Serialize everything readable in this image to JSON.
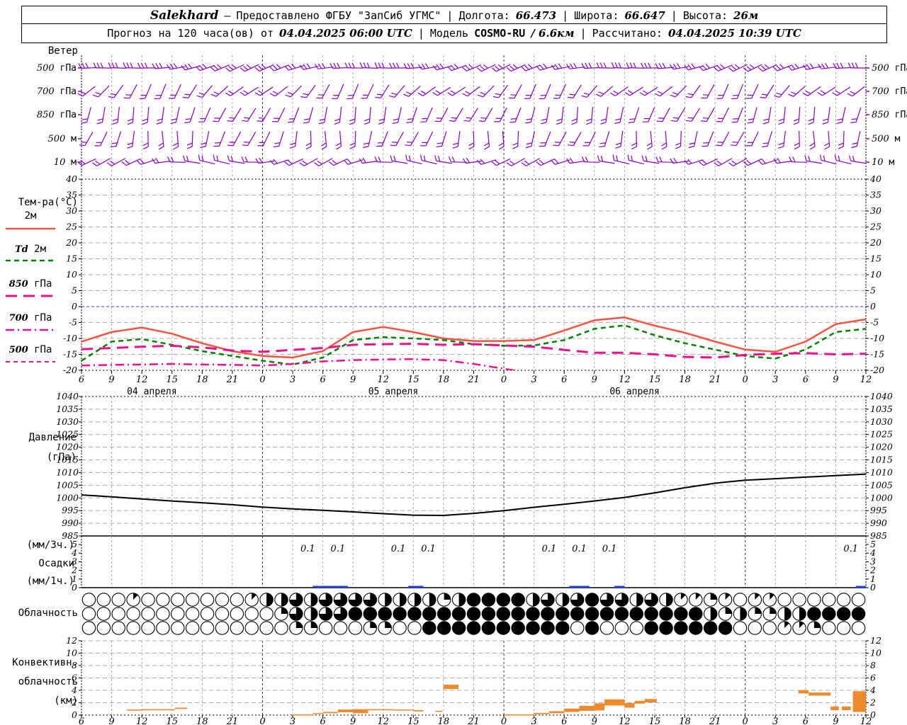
{
  "header": {
    "station": "Salekhard",
    "dash": "–",
    "provider": "Предоставлено ФГБУ \"ЗапСиб УГМС\"",
    "sep": "|",
    "lon_label": "Долгота:",
    "lon": "66.473",
    "lat_label": "Широта:",
    "lat": "66.647",
    "alt_label": "Высота:",
    "alt": "26м",
    "forecast_label": "Прогноз на 120 часа(ов) от",
    "forecast_time": "04.04.2025 06:00 UTC",
    "model_label": "Модель",
    "model_name": "COSMO-RU",
    "model_res": "/ 6.6км",
    "calc_label": "Рассчитано:",
    "calc_time": "04.04.2025 10:39 UTC"
  },
  "axis": {
    "start": "04.04.2025 06:00 UTC",
    "step_hours": 3,
    "hour_labels": [
      "6",
      "9",
      "12",
      "15",
      "18",
      "21",
      "0",
      "3",
      "6",
      "9",
      "12",
      "15",
      "18",
      "21",
      "0",
      "3",
      "6",
      "9",
      "12",
      "15",
      "18",
      "21",
      "0",
      "3",
      "6",
      "9",
      "12"
    ],
    "date_labels": [
      "04 апреля",
      "05 апреля",
      "06 апреля"
    ],
    "date_center_t": [
      7,
      31,
      55
    ]
  },
  "chart_data": [
    {
      "id": "wind",
      "type": "wind-barbs",
      "title": "Ветер",
      "color": "#8B00CB",
      "n_barbs": 53,
      "levels": [
        {
          "num": "500",
          "unit": "гПа",
          "base": -12,
          "amp": 14,
          "period": 17,
          "phase": 2,
          "ticks": 3
        },
        {
          "num": "700",
          "unit": "гПа",
          "base": -50,
          "amp": 18,
          "period": 13,
          "phase": 5,
          "ticks": 2
        },
        {
          "num": "850",
          "unit": "гПа",
          "base": -72,
          "amp": 14,
          "period": 15,
          "phase": 8,
          "ticks": 2
        },
        {
          "num": "500",
          "unit": "м",
          "base": -78,
          "amp": 18,
          "period": 11,
          "phase": 3,
          "ticks": 2
        },
        {
          "num": "10",
          "unit": "м",
          "base": -8,
          "amp": 22,
          "period": 14,
          "phase": 9,
          "ticks": 2
        }
      ]
    },
    {
      "id": "temperature",
      "type": "line",
      "title": "Тем-ра(°C)",
      "ylim": [
        -20,
        40
      ],
      "ytick_step": 5,
      "zero_line_color": "#3A3AFF",
      "x_step_hours": 3,
      "series": [
        {
          "label_num": "",
          "label_unit": "2м",
          "dash": "solid",
          "color": "#F9523E",
          "values": [
            -11,
            -8,
            -6.6,
            -8.5,
            -11.5,
            -14,
            -15.5,
            -16,
            -14,
            -8,
            -6.4,
            -8,
            -10,
            -10.8,
            -10.8,
            -10.5,
            -7.5,
            -4.3,
            -3.4,
            -6,
            -8.2,
            -11,
            -13.5,
            -14.2,
            -11,
            -5.5,
            -4
          ]
        },
        {
          "label_num": "Td",
          "label_unit": "2м",
          "dash": "dash",
          "color": "#008200",
          "values": [
            -17,
            -11,
            -10.2,
            -12,
            -14,
            -15.5,
            -17,
            -18.2,
            -16,
            -10.5,
            -9.6,
            -10,
            -10.5,
            -11.8,
            -12.3,
            -12.2,
            -10.5,
            -7,
            -5.9,
            -9,
            -11.5,
            -13.5,
            -15.5,
            -16.3,
            -13.5,
            -8,
            -7
          ]
        },
        {
          "label_num": "850",
          "label_unit": "гПа",
          "dash": "longdash",
          "color": "#EE1289",
          "values": [
            -13.4,
            -13,
            -12.6,
            -12.3,
            -12.8,
            -13.8,
            -14.2,
            -13.6,
            -13,
            -12,
            -11.8,
            -11.7,
            -12,
            -11.8,
            -12.2,
            -12.6,
            -13.6,
            -14.5,
            -14.5,
            -15,
            -15.8,
            -16,
            -15.2,
            -14.8,
            -14.6,
            -15,
            -14.8
          ]
        },
        {
          "label_num": "700",
          "label_unit": "гПа",
          "dash": "dashdot",
          "color": "#EE1289",
          "values": [
            -18.5,
            -18.3,
            -18.2,
            -18,
            -18.2,
            -18.3,
            -18.5,
            -18,
            -17.2,
            -16.8,
            -16.6,
            -16.5,
            -16.8,
            -18,
            -19.5,
            -21
          ]
        },
        {
          "label_num": "500",
          "label_unit": "гПа",
          "dash": "shortdash",
          "color": "#EE1289",
          "values": []
        }
      ]
    },
    {
      "id": "pressure",
      "type": "line",
      "title_lines": [
        "Давление",
        "(гПа)"
      ],
      "ylim": [
        985,
        1040
      ],
      "ytick_step": 5,
      "color": "#000000",
      "values": [
        1001.2,
        1000.4,
        999.6,
        998.8,
        998.1,
        997.3,
        996.4,
        995.7,
        995.1,
        994.5,
        993.8,
        993.2,
        993.1,
        993.9,
        995,
        996.3,
        997.5,
        998.8,
        1000.2,
        1002,
        1004,
        1005.8,
        1007,
        1007.6,
        1008.2,
        1008.8,
        1009.4
      ]
    },
    {
      "id": "precip",
      "type": "bar",
      "title_lines": [
        "(мм/3ч.)",
        "Осадки",
        "(мм/1ч.)"
      ],
      "ylim": [
        0,
        6
      ],
      "yticks": [
        5,
        4,
        3,
        2,
        1,
        0
      ],
      "color": "#2244DD",
      "labels_3h": [
        {
          "t_mid": 22.5,
          "text": "0.1"
        },
        {
          "t_mid": 25.5,
          "text": "0.1"
        },
        {
          "t_mid": 31.5,
          "text": "0.1"
        },
        {
          "t_mid": 34.5,
          "text": "0.1"
        },
        {
          "t_mid": 46.5,
          "text": "0.1"
        },
        {
          "t_mid": 49.5,
          "text": "0.1"
        },
        {
          "t_mid": 52.5,
          "text": "0.1"
        },
        {
          "t_mid": 76.5,
          "text": "0.1"
        }
      ],
      "bars_1h": [
        {
          "t1": 23,
          "t2": 26.5,
          "mm": 0.12
        },
        {
          "t1": 32.5,
          "t2": 34,
          "mm": 0.1
        },
        {
          "t1": 48.5,
          "t2": 50.5,
          "mm": 0.15
        },
        {
          "t1": 53,
          "t2": 54,
          "mm": 0.12
        },
        {
          "t1": 77,
          "t2": 78,
          "mm": 0.15
        }
      ]
    },
    {
      "id": "cloud",
      "type": "cloud-cover",
      "title": "Облачность",
      "octas_scale": 8,
      "rows": [
        [
          0,
          0,
          0,
          1,
          0,
          0,
          0,
          0,
          0,
          0,
          0,
          1,
          4,
          4,
          6,
          4,
          6,
          6,
          6,
          6,
          4,
          4,
          4,
          4,
          2,
          4,
          8,
          8,
          8,
          8,
          4,
          6,
          4,
          6,
          8,
          6,
          6,
          4,
          6,
          4,
          1,
          1,
          2,
          1,
          0,
          1,
          1,
          0,
          0,
          0,
          0,
          0,
          0
        ],
        [
          0,
          0,
          0,
          0,
          0,
          0,
          0,
          0,
          0,
          0,
          0,
          0,
          0,
          2,
          6,
          4,
          6,
          6,
          8,
          8,
          8,
          8,
          8,
          8,
          8,
          8,
          8,
          8,
          8,
          8,
          8,
          8,
          8,
          8,
          8,
          8,
          8,
          8,
          8,
          8,
          8,
          8,
          4,
          2,
          4,
          2,
          2,
          4,
          4,
          8,
          8,
          8,
          8
        ],
        [
          0,
          0,
          0,
          0,
          0,
          0,
          0,
          0,
          0,
          0,
          0,
          0,
          0,
          0,
          2,
          2,
          0,
          0,
          0,
          2,
          2,
          0,
          0,
          8,
          8,
          8,
          8,
          8,
          8,
          8,
          8,
          8,
          8,
          0,
          8,
          0,
          0,
          0,
          8,
          8,
          8,
          8,
          8,
          8,
          0,
          0,
          0,
          1,
          1,
          2,
          0,
          0,
          0
        ]
      ]
    },
    {
      "id": "convective",
      "type": "blocks",
      "title_lines": [
        "Конвективн.",
        "облачность",
        "(км)"
      ],
      "ylim": [
        0,
        12
      ],
      "ytick_step": 2,
      "color": "#EF8A2C",
      "blocks": [
        [
          4.5,
          6,
          0.72,
          0.9
        ],
        [
          6,
          9.3,
          0.78,
          0.95
        ],
        [
          9.3,
          10.5,
          1.0,
          1.2
        ],
        [
          21,
          23,
          0.02,
          0.12
        ],
        [
          23,
          24,
          0.18,
          0.33
        ],
        [
          24,
          25.5,
          0.3,
          0.52
        ],
        [
          25.5,
          27,
          0.45,
          0.9
        ],
        [
          27,
          28.5,
          0.3,
          0.95
        ],
        [
          28.5,
          31,
          0.78,
          0.95
        ],
        [
          31,
          33,
          0.75,
          0.9
        ],
        [
          33,
          34,
          0.6,
          0.8
        ],
        [
          35.2,
          35.9,
          0.55,
          0.7
        ],
        [
          36,
          37.5,
          4.2,
          4.9
        ],
        [
          42,
          45,
          0.02,
          0.12
        ],
        [
          45,
          46.5,
          0.15,
          0.35
        ],
        [
          46.5,
          48,
          0.3,
          0.62
        ],
        [
          48,
          49.5,
          0.5,
          1.05
        ],
        [
          49.5,
          51,
          0.7,
          1.5
        ],
        [
          51,
          52,
          0.75,
          1.9
        ],
        [
          52,
          54,
          1.55,
          2.55
        ],
        [
          54,
          55,
          1.2,
          1.95
        ],
        [
          55,
          56,
          1.85,
          2.3
        ],
        [
          56,
          57.2,
          2.05,
          2.6
        ],
        [
          71.3,
          72.3,
          3.5,
          4.05
        ],
        [
          72.3,
          74.5,
          3.15,
          3.65
        ],
        [
          74.5,
          75.3,
          0.8,
          1.4
        ],
        [
          75.6,
          76.5,
          0.8,
          1.4
        ],
        [
          76.7,
          78,
          0.5,
          3.85
        ]
      ]
    }
  ]
}
